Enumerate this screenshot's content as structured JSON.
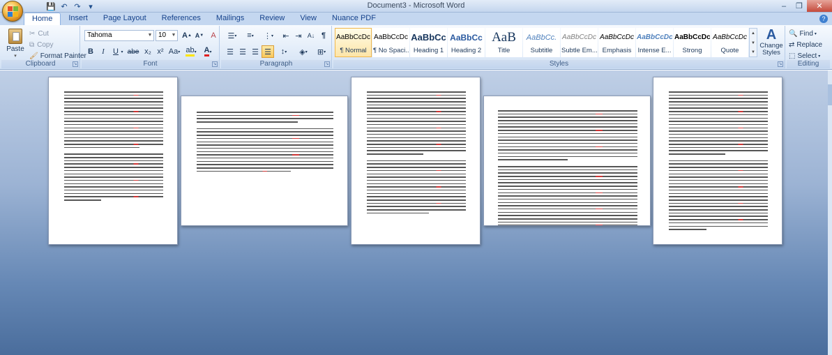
{
  "window": {
    "title": "Document3 - Microsoft Word"
  },
  "quick_access": {
    "save": "💾",
    "undo": "↶",
    "redo": "↷",
    "more": "▾"
  },
  "tabs": [
    "Home",
    "Insert",
    "Page Layout",
    "References",
    "Mailings",
    "Review",
    "View",
    "Nuance PDF"
  ],
  "clipboard": {
    "paste": "Paste",
    "cut": "Cut",
    "copy": "Copy",
    "format_painter": "Format Painter",
    "label": "Clipboard"
  },
  "font": {
    "name": "Tahoma",
    "size": "10",
    "label": "Font",
    "bold": "B",
    "italic": "I",
    "underline": "U",
    "strike": "abe",
    "subscript": "x₂",
    "superscript": "x²",
    "change_case": "Aa",
    "grow": "A",
    "shrink": "A",
    "clear": "A"
  },
  "paragraph": {
    "label": "Paragraph"
  },
  "styles": {
    "label": "Styles",
    "items": [
      {
        "sample": "AaBbCcDc",
        "name": "¶ Normal"
      },
      {
        "sample": "AaBbCcDc",
        "name": "¶ No Spaci..."
      },
      {
        "sample": "AaBbCc",
        "name": "Heading 1"
      },
      {
        "sample": "AaBbCc",
        "name": "Heading 2"
      },
      {
        "sample": "AaB",
        "name": "Title"
      },
      {
        "sample": "AaBbCc.",
        "name": "Subtitle"
      },
      {
        "sample": "AaBbCcDc",
        "name": "Subtle Em..."
      },
      {
        "sample": "AaBbCcDc",
        "name": "Emphasis"
      },
      {
        "sample": "AaBbCcDc",
        "name": "Intense E..."
      },
      {
        "sample": "AaBbCcDc",
        "name": "Strong"
      },
      {
        "sample": "AaBbCcDc",
        "name": "Quote"
      }
    ],
    "change_styles": "Change Styles"
  },
  "editing": {
    "label": "Editing",
    "find": "Find",
    "replace": "Replace",
    "select": "Select"
  },
  "colors": {
    "accent": "#15428b",
    "ribbon_bg": "#dfe9f5",
    "doc_bg": "#6f8fbf"
  }
}
